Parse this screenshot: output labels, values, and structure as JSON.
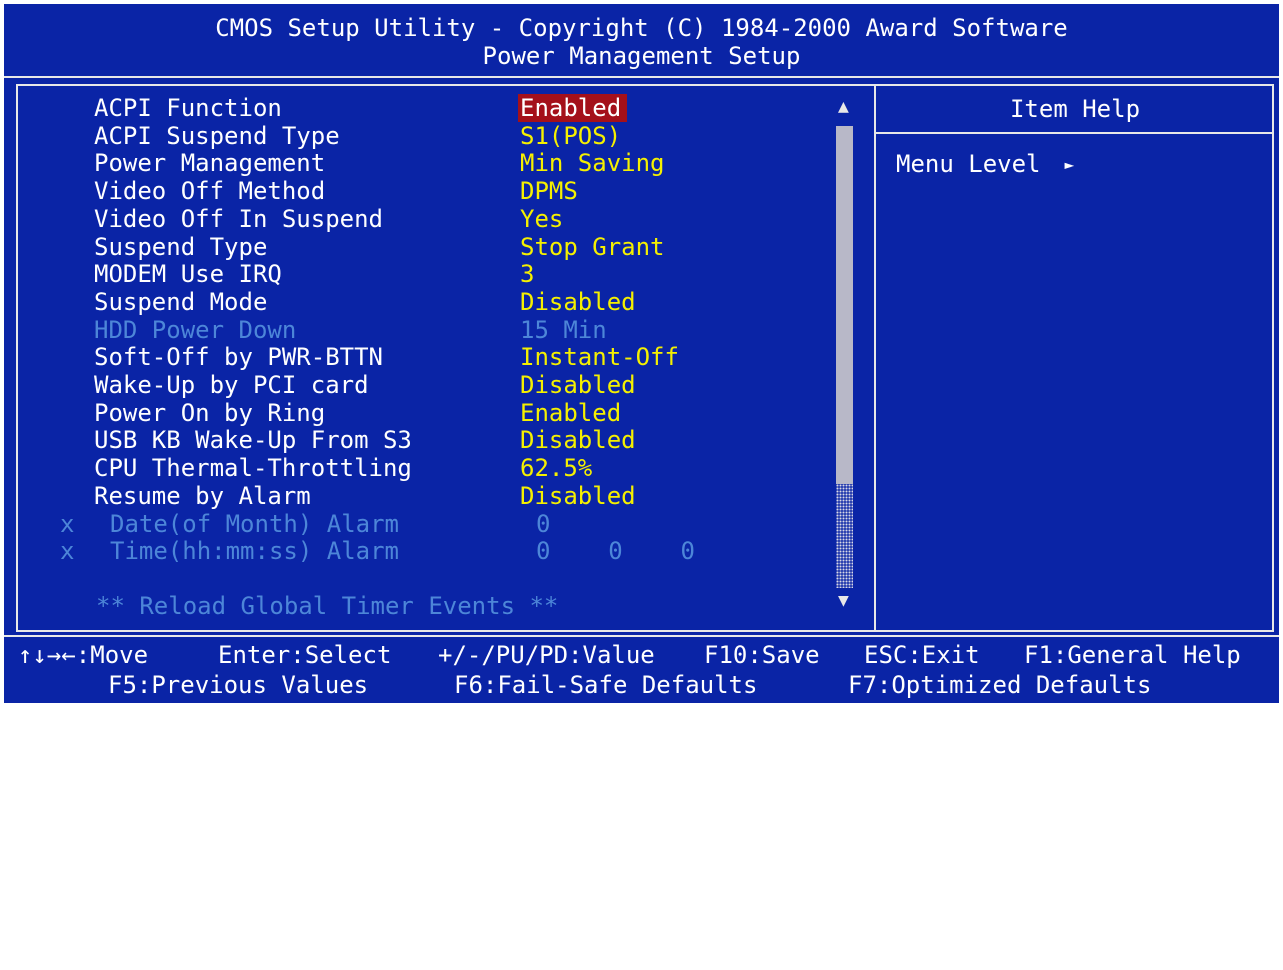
{
  "header": {
    "title": "CMOS Setup Utility - Copyright (C) 1984-2000 Award Software",
    "subtitle": "Power Management Setup"
  },
  "items": [
    {
      "label": "ACPI Function",
      "value": "Enabled",
      "selected": true
    },
    {
      "label": "ACPI Suspend Type",
      "value": "S1(POS)"
    },
    {
      "label": "Power Management",
      "value": "Min Saving"
    },
    {
      "label": "Video Off Method",
      "value": "DPMS"
    },
    {
      "label": "Video Off In Suspend",
      "value": "Yes"
    },
    {
      "label": "Suspend Type",
      "value": "Stop Grant"
    },
    {
      "label": "MODEM Use IRQ",
      "value": "3"
    },
    {
      "label": "Suspend Mode",
      "value": "Disabled"
    },
    {
      "label": "HDD Power Down",
      "value": "15 Min",
      "disabled": true
    },
    {
      "label": "Soft-Off by PWR-BTTN",
      "value": "Instant-Off"
    },
    {
      "label": "Wake-Up by PCI card",
      "value": "Disabled"
    },
    {
      "label": "Power On by Ring",
      "value": "Enabled"
    },
    {
      "label": "USB KB Wake-Up From S3",
      "value": "Disabled"
    },
    {
      "label": "CPU Thermal-Throttling",
      "value": "62.5%"
    },
    {
      "label": "Resume by Alarm",
      "value": "Disabled"
    },
    {
      "label": "Date(of Month) Alarm",
      "value": "0",
      "prefix": "x",
      "disabled": true
    },
    {
      "label": "Time(hh:mm:ss) Alarm",
      "value": "0    0    0",
      "prefix": "x",
      "disabled": true
    }
  ],
  "reload": "** Reload Global Timer Events **",
  "help": {
    "title": "Item Help",
    "menu_level": "Menu Level"
  },
  "icons": {
    "scroll_up": "up-arrow-icon",
    "scroll_down": "down-arrow-icon",
    "menu_level_arrow": "right-triangle-icon"
  },
  "footer": {
    "move": "↑↓→←:Move",
    "enter": "Enter:Select",
    "value": "+/-/PU/PD:Value",
    "save": "F10:Save",
    "esc": "ESC:Exit",
    "f1": "F1:General Help",
    "f5": "F5:Previous Values",
    "f6": "F6:Fail-Safe Defaults",
    "f7": "F7:Optimized Defaults"
  },
  "colors": {
    "background": "#0a24a6",
    "label": "#ffffff",
    "value": "#f5f000",
    "disabled": "#4d86d8",
    "selected_bg": "#a4101a"
  }
}
